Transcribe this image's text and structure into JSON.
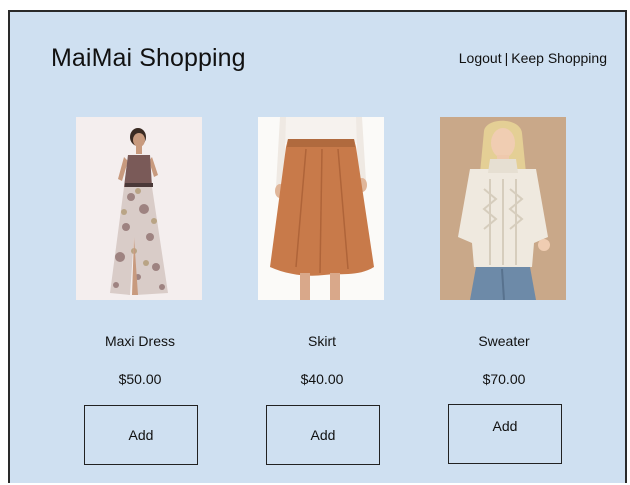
{
  "header": {
    "title": "MaiMai Shopping",
    "logout_label": "Logout",
    "separator": "|",
    "keep_shopping_label": "Keep Shopping"
  },
  "products": [
    {
      "name": "Maxi Dress",
      "price": "$50.00",
      "add_label": "Add",
      "image": "maxi-dress-photo"
    },
    {
      "name": "Skirt",
      "price": "$40.00",
      "add_label": "Add",
      "image": "skirt-photo"
    },
    {
      "name": "Sweater",
      "price": "$70.00",
      "add_label": "Add",
      "image": "sweater-photo"
    }
  ],
  "colors": {
    "background": "#cfe0f1",
    "text": "#111111",
    "border": "#222222"
  }
}
